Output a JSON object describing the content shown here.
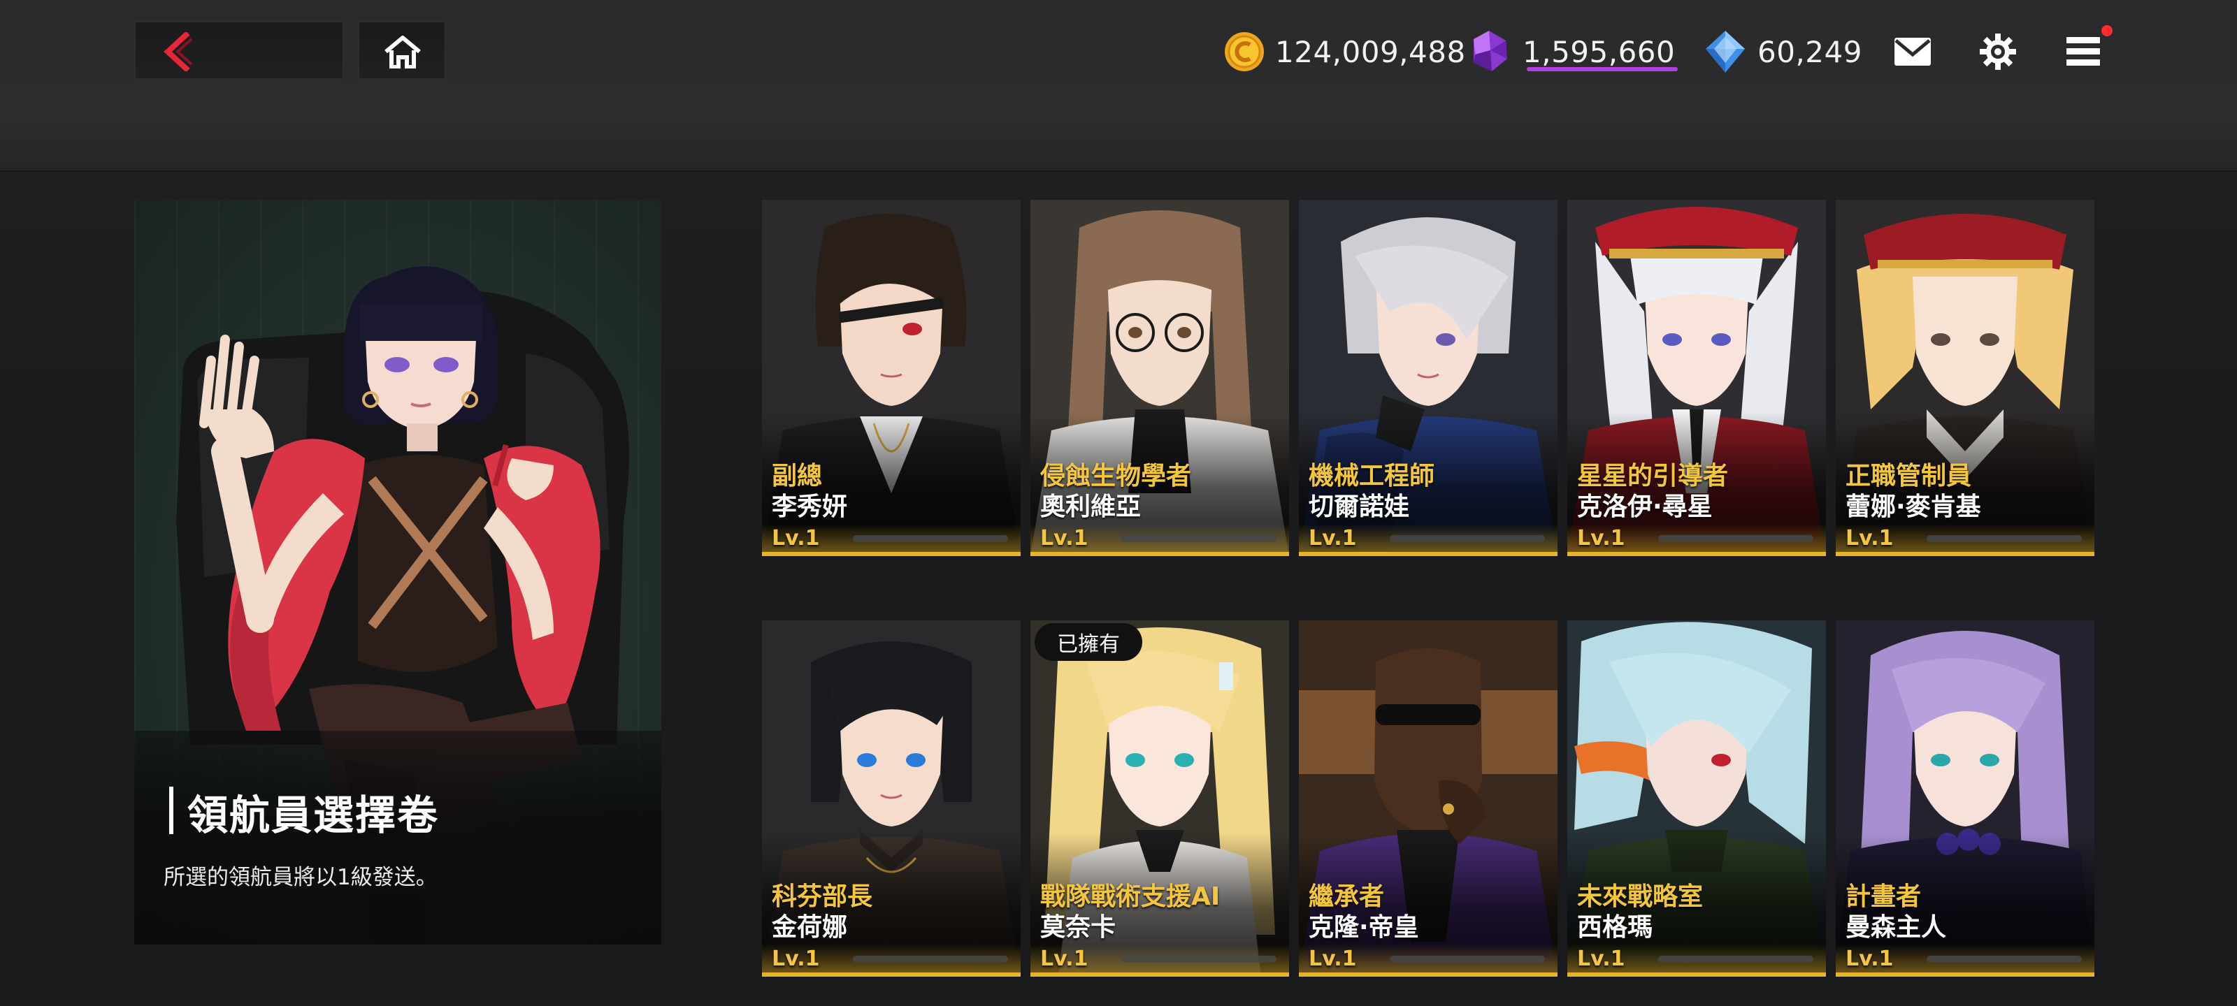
{
  "header": {
    "currencies": [
      {
        "icon": "gold-coin-icon",
        "value": "124,009,488"
      },
      {
        "icon": "purple-crystal-icon",
        "value": "1,595,660"
      },
      {
        "icon": "blue-diamond-icon",
        "value": "60,249"
      }
    ],
    "colors": {
      "gem_underline": "#b140e0",
      "notification": "#ff2a2a"
    }
  },
  "feature": {
    "title": "領航員選擇卷",
    "subtitle": "所選的領航員將以1級發送。"
  },
  "characters": [
    {
      "role": "副總",
      "name": "李秀妍",
      "level": "Lv.1",
      "owned": false
    },
    {
      "role": "侵蝕生物學者",
      "name": "奧利維亞",
      "level": "Lv.1",
      "owned": false
    },
    {
      "role": "機械工程師",
      "name": "切爾諾娃",
      "level": "Lv.1",
      "owned": false
    },
    {
      "role": "星星的引導者",
      "name": "克洛伊·尋星",
      "level": "Lv.1",
      "owned": false
    },
    {
      "role": "正職管制員",
      "name": "蕾娜·麥肯基",
      "level": "Lv.1",
      "owned": false
    },
    {
      "role": "科芬部長",
      "name": "金荷娜",
      "level": "Lv.1",
      "owned": false
    },
    {
      "role": "戰隊戰術支援AI",
      "name": "莫奈卡",
      "level": "Lv.1",
      "owned": true
    },
    {
      "role": "繼承者",
      "name": "克隆·帝皇",
      "level": "Lv.1",
      "owned": false
    },
    {
      "role": "未來戰略室",
      "name": "西格瑪",
      "level": "Lv.1",
      "owned": false
    },
    {
      "role": "計畫者",
      "name": "曼森主人",
      "level": "Lv.1",
      "owned": false
    }
  ],
  "owned_label": "已擁有",
  "accent_color": "#e8b52a",
  "role_color": "#f4c63e"
}
